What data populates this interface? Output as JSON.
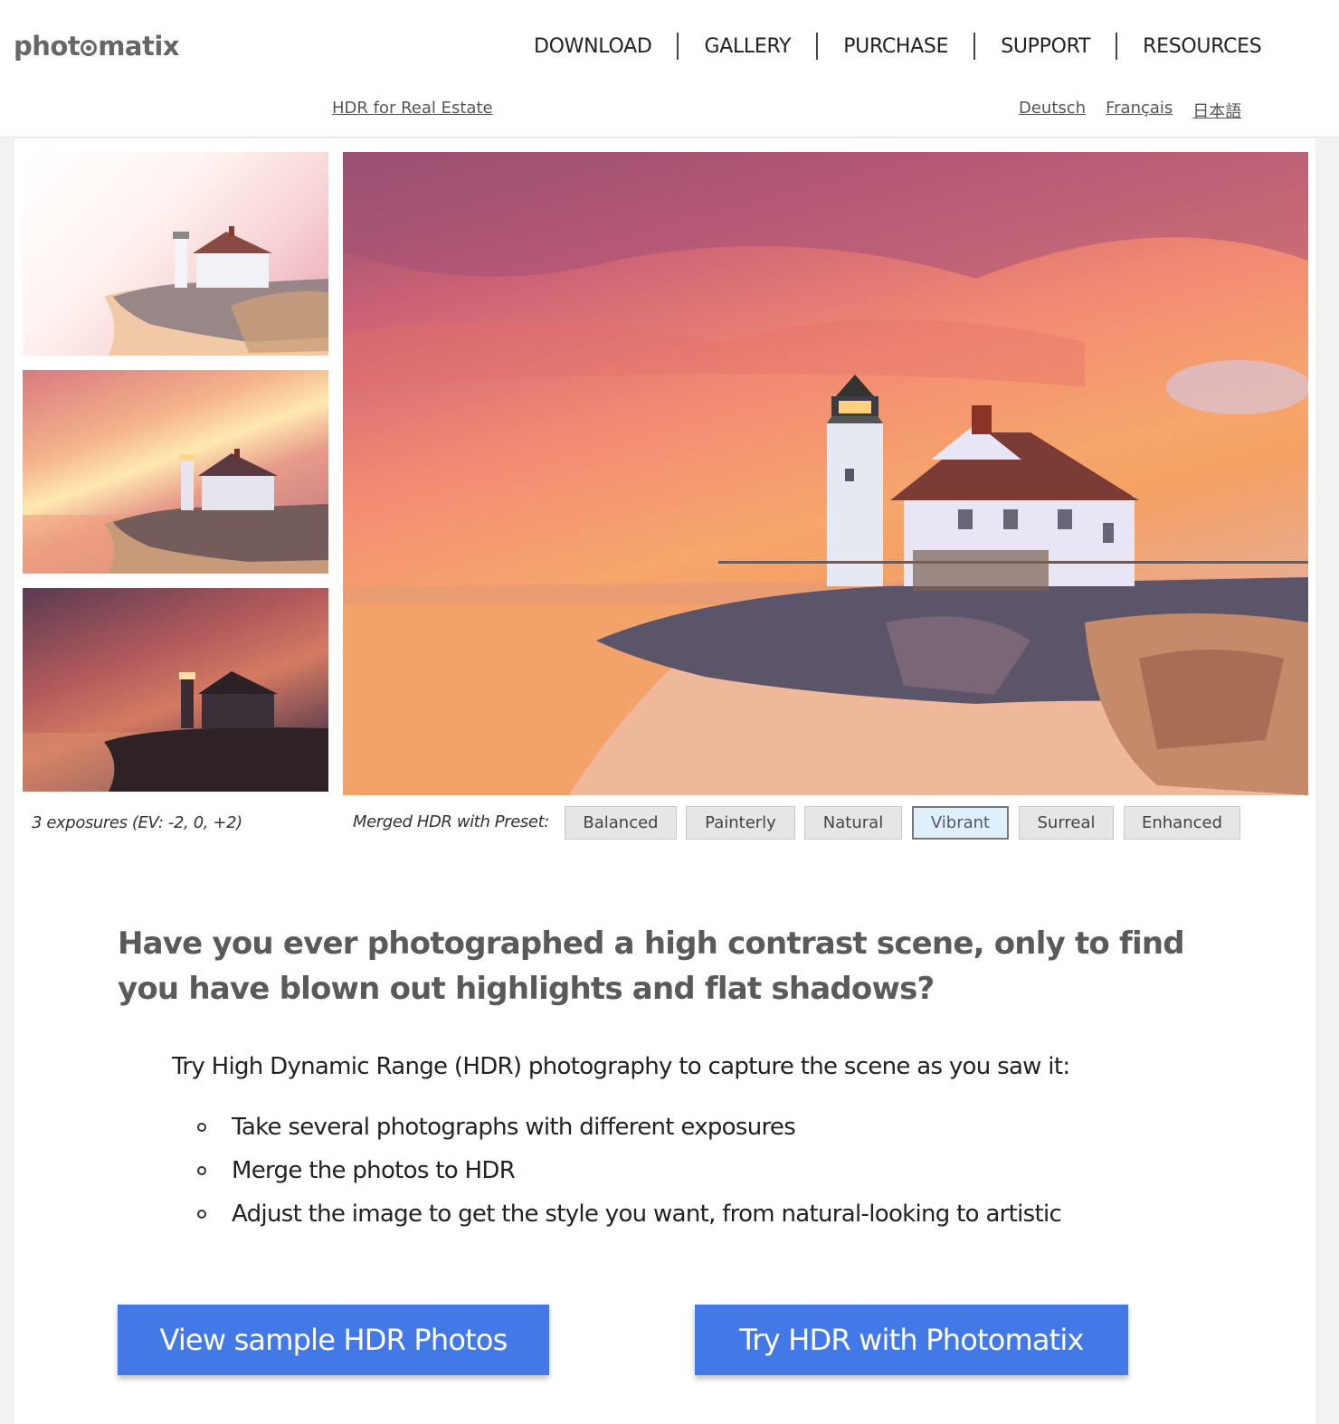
{
  "brand": {
    "logo_pre": "phot",
    "logo_post": "matix"
  },
  "nav": {
    "items": [
      {
        "label": "DOWNLOAD"
      },
      {
        "label": "GALLERY"
      },
      {
        "label": "PURCHASE"
      },
      {
        "label": "SUPPORT"
      },
      {
        "label": "RESOURCES"
      }
    ],
    "sublink": "HDR for Real Estate",
    "languages": [
      {
        "label": "Deutsch"
      },
      {
        "label": "Français"
      },
      {
        "label": "日本語"
      }
    ]
  },
  "showcase": {
    "thumbnails": [
      {
        "alt": "Overexposed lighthouse photo (+2 EV)"
      },
      {
        "alt": "Normal exposure lighthouse photo (0 EV)"
      },
      {
        "alt": "Underexposed lighthouse photo (-2 EV)"
      }
    ],
    "main_alt": "Merged HDR lighthouse photo, Vibrant preset",
    "exposures_caption": "3 exposures (EV: -2, 0, +2)",
    "preset_caption": "Merged HDR with Preset:",
    "presets": [
      {
        "label": "Balanced",
        "active": false
      },
      {
        "label": "Painterly",
        "active": false
      },
      {
        "label": "Natural",
        "active": false
      },
      {
        "label": "Vibrant",
        "active": true
      },
      {
        "label": "Surreal",
        "active": false
      },
      {
        "label": "Enhanced",
        "active": false
      }
    ]
  },
  "body": {
    "headline": "Have you ever photographed a high contrast scene, only to find you have blown out highlights and flat shadows?",
    "intro": "Try High Dynamic Range (HDR) photography to capture the scene as you saw it:",
    "steps": [
      "Take several photographs with different exposures",
      "Merge the photos to HDR",
      "Adjust the image to get the style you want, from natural-looking to artistic"
    ]
  },
  "cta": {
    "primary": "View sample HDR Photos",
    "secondary": "Try HDR with Photomatix"
  },
  "colors": {
    "cta_blue": "#4279e6",
    "active_preset_bg": "#dff0fc",
    "preset_bg": "#e6e6e6",
    "headline": "#5a5a5a"
  }
}
